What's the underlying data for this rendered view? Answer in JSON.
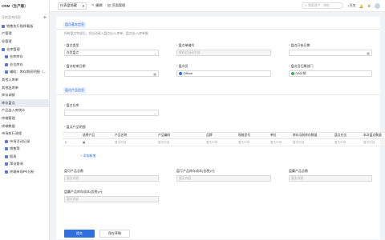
{
  "app": {
    "title": "CRM（生产版）"
  },
  "sidebar": {
    "search_placeholder": "导航菜单搜索",
    "items": [
      {
        "label": "销售执行指挥看板"
      },
      {
        "label": "产管理"
      },
      {
        "label": "仓管理"
      },
      {
        "label": "仓库管理"
      },
      {
        "label": "仓库库存"
      },
      {
        "label": "仓位库存"
      },
      {
        "label": "辅助：库存期初明细（..."
      },
      {
        "label": "其他入库单"
      },
      {
        "label": "其他出库单"
      },
      {
        "label": "库存调拨"
      },
      {
        "label": "库存盘点"
      },
      {
        "label": "产品出入库统计"
      },
      {
        "label": "终端管理"
      },
      {
        "label": "终端数据"
      },
      {
        "label": "市场执行流程"
      },
      {
        "label": "市场活动记录"
      },
      {
        "label": "销售拜"
      },
      {
        "label": "报表"
      },
      {
        "label": "拜访查询"
      },
      {
        "label": "终端市场PK分析"
      }
    ]
  },
  "topbar": {
    "view_select": "仪表盘隐藏",
    "edit_label": "编辑",
    "layout_label": "页面管理",
    "search_placeholder": "搜索客户、商机",
    "add_label": "添加",
    "more_label": "设置"
  },
  "form": {
    "section_basic": "盘点基本信息",
    "hint": "所有盘点完成后，仓自动录入盘点出/入库单，盘点出/入库单据",
    "type_label": "盘点类型",
    "type_value": "存货盘点",
    "number_label": "盘点单编号",
    "number_placeholder": "保存后自动生成",
    "start_date_label": "盘点开始日期",
    "end_date_label": "盘点结束日期",
    "owner_label": "盘点员",
    "owner_value": "Official",
    "dept_label": "盘点员归属部门",
    "dept_value": "DA分销",
    "section_product": "盘点产品信息",
    "warehouse_label": "盘点仓库",
    "detail_label": "盘点产品明细",
    "add_product": "+ 添加新笔",
    "total_count_label": "盘可产品总数",
    "total_count_placeholder": "暂无内容",
    "diff_amount_label": "盘亏产品库存成本(含税)/元",
    "diff_amount_placeholder": "暂无内容",
    "surplus_count_label": "盘赢产品总数",
    "surplus_count_placeholder": "暂无内容",
    "surplus_amount_label": "盘赢产品库存成本(含税)/元",
    "surplus_amount_placeholder": "暂无内容"
  },
  "table": {
    "columns": [
      "选择产品",
      "产品名称",
      "产品编码",
      "品牌",
      "规格型号",
      "单位",
      "库存当前库存数量",
      "盘点仓位",
      "本次盘点数量"
    ],
    "rows": [
      {
        "index": "1",
        "cells": [
          "暂无内容",
          "暂无内容",
          "暂无内容",
          "暂无内容",
          "暂无内容",
          "暂无内容",
          "暂无内容",
          "暂无内容"
        ]
      }
    ]
  },
  "footer": {
    "submit_label": "提交",
    "save_draft_label": "保存草稿"
  },
  "colors": {
    "accent": "#2f6fde",
    "required": "#e84040"
  }
}
